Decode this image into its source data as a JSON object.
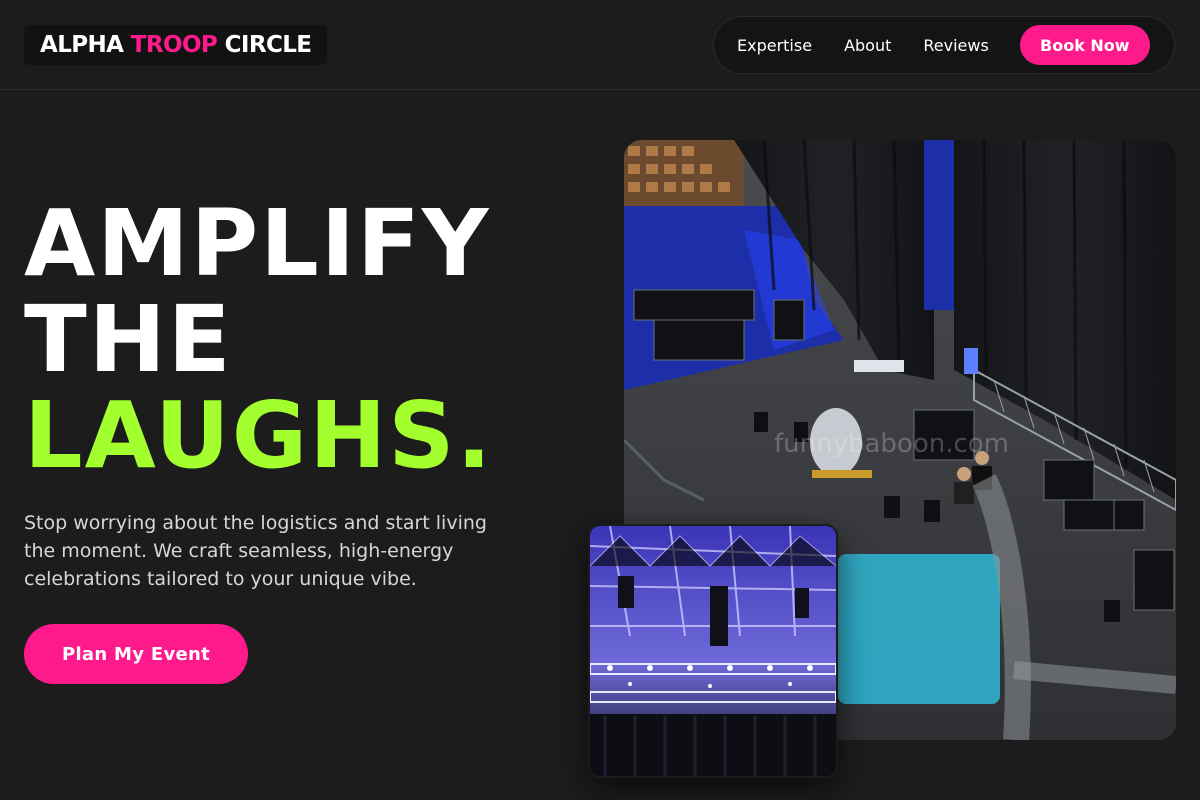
{
  "brand": {
    "part1": "ALPHA",
    "part2": "TROOP",
    "part3": "CIRCLE"
  },
  "nav": {
    "links": [
      "Expertise",
      "About",
      "Reviews"
    ],
    "cta": "Book Now"
  },
  "hero": {
    "title_line1": "AMPLIFY",
    "title_line2": "THE",
    "title_line3": "LAUGHS.",
    "subtitle": "Stop worrying about the logistics and start living the moment. We craft seamless, high-energy celebrations tailored to your unique vibe.",
    "cta": "Plan My Event"
  },
  "images": {
    "main_watermark": "funnybaboon.com"
  },
  "colors": {
    "background": "#1c1c1c",
    "accent_pink": "#ff1a8c",
    "accent_green": "#a3ff2e"
  }
}
